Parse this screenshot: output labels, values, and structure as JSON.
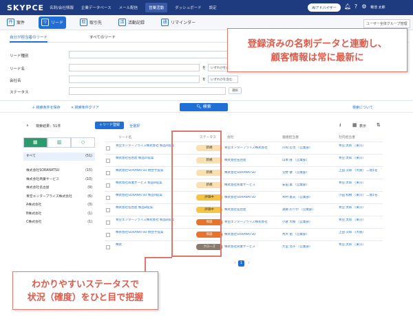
{
  "app": {
    "logo": "SKYPCE",
    "nav": [
      "名刺/会社情報",
      "企業データベース",
      "メール配信",
      "営業活動",
      "ダッシュボード",
      "設定"
    ],
    "active_nav": "営業活動",
    "ai_button": "AIアドバイザー",
    "user": "菊池 太郎"
  },
  "modules": [
    {
      "label": "案件",
      "icon": "件",
      "active": false
    },
    {
      "label": "リード",
      "icon": "リ",
      "active": true
    },
    {
      "label": "取引先",
      "icon": "取",
      "active": false
    },
    {
      "label": "活動記録",
      "icon": "活",
      "active": false
    },
    {
      "label": "リマインダー",
      "icon": "通",
      "active": false
    }
  ],
  "group_button": "ユーザー全体グループ管理",
  "subtabs": [
    "自分が担当者のリード",
    "すべてのリード"
  ],
  "form": {
    "lead_type": "リード種別",
    "lead_name": "リード名",
    "company": "会社名",
    "status": "ステータス",
    "contains": "を",
    "match_option": "いずれかを含む",
    "select_btn": "選択"
  },
  "search": {
    "save": "＋ 検索条件を保存",
    "clear": "✕ 検索条件クリア",
    "button": "検索",
    "about": "検索について"
  },
  "results": {
    "label": "検索結果：51件",
    "lead_reg": "リード登録",
    "select_all": "全選択",
    "display": "表示"
  },
  "filter_panel": {
    "tabs": [
      "▦",
      "▥",
      "◇"
    ],
    "items": [
      {
        "name": "すべて",
        "count": "(51)",
        "selected": true
      },
      {
        "name": "株式会社SORANATSU",
        "count": "(15)"
      },
      {
        "name": "株式会社商業サービス",
        "count": "(10)"
      },
      {
        "name": "株式会社名古屋",
        "count": "(9)"
      },
      {
        "name": "青空エンタープライズ株式会社",
        "count": "(6)"
      },
      {
        "name": "A株式会社",
        "count": "(3)"
      },
      {
        "name": "B株式会社",
        "count": "(1)"
      },
      {
        "name": "C株式会社",
        "count": "(1)"
      }
    ]
  },
  "table": {
    "headers": [
      "リード名",
      "ステータス",
      "会社",
      "連絡担当者",
      "社内担当者"
    ],
    "rows": [
      {
        "name": "青空エンタープライズ株式会社 製品A提案",
        "status": "新規",
        "status_color": "#fbdfb0",
        "company": "青空エンタープライズ株式会社",
        "contact": "川和 宏也 〈営業部〉",
        "owner": "青空 太郎 〈東京〉"
      },
      {
        "name": "株式会社名古屋 製品の提案",
        "status": "新規",
        "status_color": "#fbdfb0",
        "company": "株式会社名古屋",
        "contact": "山本 隆 〈営業部〉",
        "owner": "青空 太郎 〈東京〉"
      },
      {
        "name": "株式会社SORANATSU 問合せ提案",
        "status": "新規",
        "status_color": "#fbdfb0",
        "company": "株式会社SORANATSU",
        "contact": "堂野 健 〈営業部〉",
        "owner": "上田 次郎 〈大阪〉 二階1名"
      },
      {
        "name": "株式会社商業サービス 製品B提案",
        "status": "新規",
        "status_color": "#fbdfb0",
        "company": "株式会社商業サービス",
        "contact": "安田 薫 〈営業部〉",
        "owner": "青空 太郎 〈東京〉"
      },
      {
        "name": "株式会社SORANATSU 製品A提案",
        "status": "評価中",
        "status_color": "#f5c542",
        "company": "株式会社SORANATSU",
        "contact": "木村 憲夫 〈営業部〉",
        "owner": "小田 和樹 〈東京〉 二階1名"
      },
      {
        "name": "株式会社名古屋 製品B提案",
        "status": "評価中",
        "status_color": "#f5c542",
        "company": "株式会社名古屋",
        "contact": "遠藤 のりか 〈営業部〉",
        "owner": "青空 太郎 〈東京〉"
      },
      {
        "name": "青空エンタープライズ株式会社 製品B提案",
        "status": "商談",
        "status_color": "#e8742b",
        "company": "青空エンタープライズ株式会社",
        "contact": "小倉 大樹 〈営業部〉",
        "owner": "青空 太郎 〈東京〉"
      },
      {
        "name": "株式会社SORANATSU 問合せ提案",
        "status": "商談",
        "status_color": "#e8742b",
        "company": "株式会社SORANATSU",
        "contact": "馬大 祐 〈営業部〉",
        "owner": "上田 次郎 〈大阪〉"
      },
      {
        "name": "株式",
        "status": "クローズ",
        "status_color": "#8a7a6e",
        "company": "株式会社商業サービス",
        "contact": "大室 治子 〈営業部〉",
        "owner": "青空 太郎 〈東京〉"
      }
    ]
  },
  "pager": {
    "prev": "‹",
    "page": "1",
    "next": "›"
  },
  "callouts": {
    "top_line1": "登録済みの名刺データと連動し、",
    "top_line2": "顧客情報は常に最新に",
    "bottom_line1": "わかりやすいステータスで",
    "bottom_line2": "状況（確度）をひと目で把握"
  },
  "colors": {
    "navy": "#1f3b80",
    "accent": "#1f6fd6",
    "callout": "#e05a4a",
    "green": "#2c9a6b"
  }
}
